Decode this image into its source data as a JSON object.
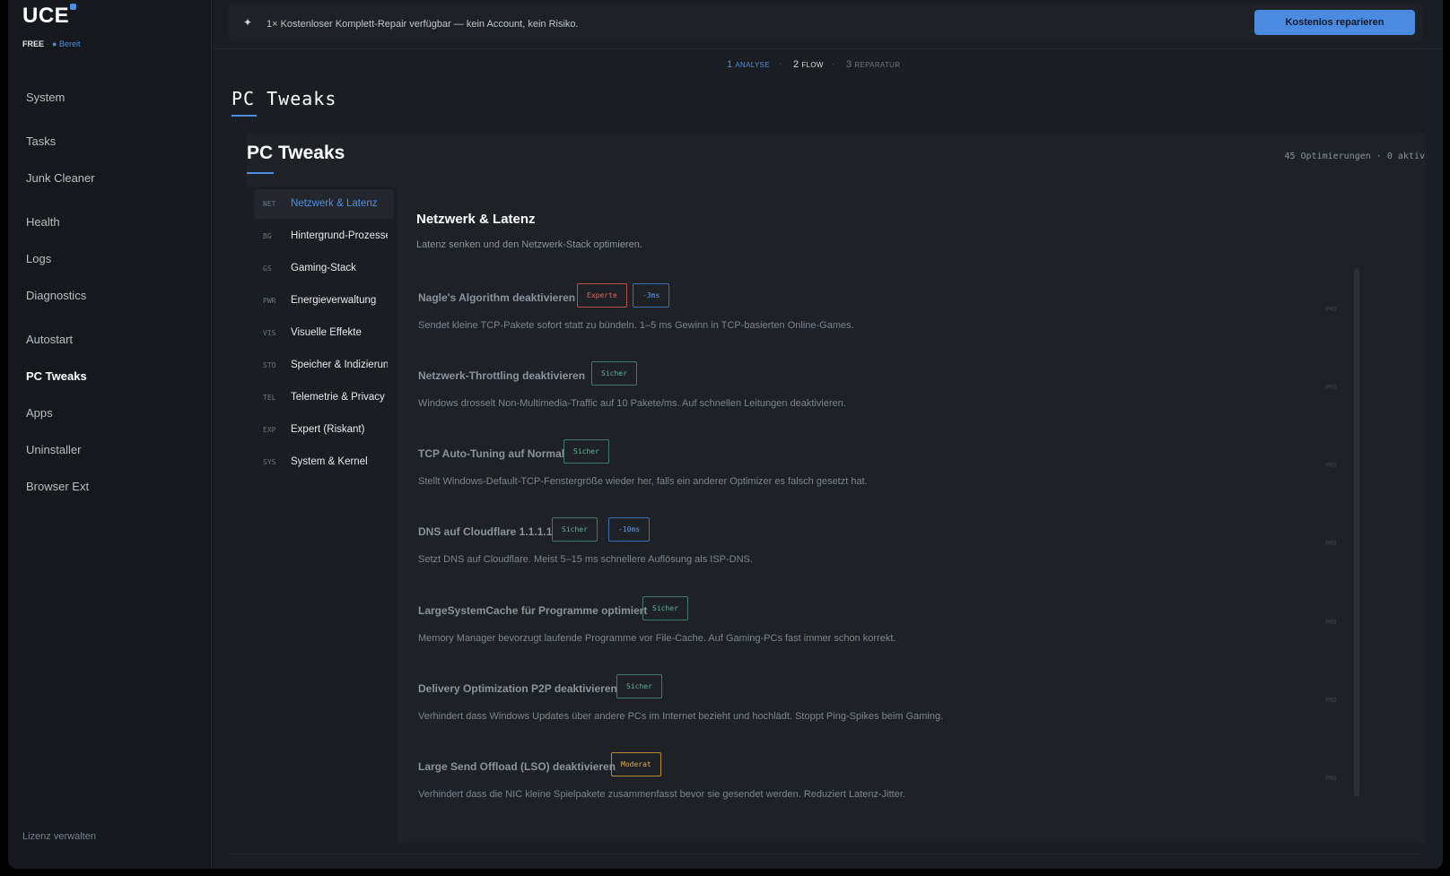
{
  "app": {
    "logo": "UCE",
    "plan": "FREE",
    "status": "Bereit",
    "license_link": "Lizenz verwalten"
  },
  "sidebar": {
    "items": [
      {
        "label": "System"
      },
      {
        "label": "Tasks"
      },
      {
        "label": "Junk Cleaner"
      },
      {
        "label": "Health"
      },
      {
        "label": "Logs"
      },
      {
        "label": "Diagnostics"
      },
      {
        "label": "Autostart"
      },
      {
        "label": "PC Tweaks"
      },
      {
        "label": "Apps"
      },
      {
        "label": "Uninstaller"
      },
      {
        "label": "Browser Ext"
      }
    ],
    "active": "PC Tweaks"
  },
  "promo": {
    "icon": "sparkle-icon",
    "text": "1× Kostenloser Komplett-Repair verfügbar — kein Account, kein Risiko.",
    "button": "Kostenlos reparieren"
  },
  "steps": [
    {
      "num": "1",
      "label": "ANALYSE"
    },
    {
      "num": "2",
      "label": "FLOW"
    },
    {
      "num": "3",
      "label": "REPARATUR"
    }
  ],
  "page": {
    "title": "PC  Tweaks"
  },
  "card": {
    "title": "PC Tweaks",
    "meta": "45 Optimierungen · 0 aktiv"
  },
  "subnav": [
    {
      "code": "NET",
      "label": "Netzwerk & Latenz"
    },
    {
      "code": "BG",
      "label": "Hintergrund-Prozesse"
    },
    {
      "code": "GS",
      "label": "Gaming-Stack"
    },
    {
      "code": "PWR",
      "label": "Energieverwaltung"
    },
    {
      "code": "VIS",
      "label": "Visuelle Effekte"
    },
    {
      "code": "STO",
      "label": "Speicher & Indizierung"
    },
    {
      "code": "TEL",
      "label": "Telemetrie & Privacy"
    },
    {
      "code": "EXP",
      "label": "Expert (Riskant)"
    },
    {
      "code": "SYS",
      "label": "System & Kernel"
    }
  ],
  "section": {
    "title": "Netzwerk & Latenz",
    "desc": "Latenz senken und den Netzwerk-Stack optimieren."
  },
  "tweaks": [
    {
      "title": "Nagle's Algorithm deaktivieren",
      "badges": [
        "Experte",
        "-3ms"
      ],
      "desc": "Sendet kleine TCP-Pakete sofort statt zu bündeln. 1–5 ms Gewinn in TCP-basierten Online-Games.",
      "pro": "PRO"
    },
    {
      "title": "Netzwerk-Throttling deaktivieren",
      "badges": [
        "Sicher"
      ],
      "desc": "Windows drosselt Non-Multimedia-Traffic auf 10 Pakete/ms. Auf schnellen Leitungen deaktivieren.",
      "pro": "PRO"
    },
    {
      "title": "TCP Auto-Tuning auf Normal",
      "badges": [
        "Sicher"
      ],
      "desc": "Stellt Windows-Default-TCP-Fenstergröße wieder her, falls ein anderer Optimizer es falsch gesetzt hat.",
      "pro": "PRO"
    },
    {
      "title": "DNS auf Cloudflare 1.1.1.1",
      "badges": [
        "Sicher",
        "-10ms"
      ],
      "desc": "Setzt DNS auf Cloudflare. Meist 5–15 ms schnellere Auflösung als ISP-DNS.",
      "pro": "PRO"
    },
    {
      "title": "LargeSystemCache für Programme optimiert",
      "badges": [
        "Sicher"
      ],
      "desc": "Memory Manager bevorzugt laufende Programme vor File-Cache. Auf Gaming-PCs fast immer schon korrekt.",
      "pro": "PRO"
    },
    {
      "title": "Delivery Optimization P2P deaktivieren",
      "badges": [
        "Sicher"
      ],
      "desc": "Verhindert dass Windows Updates über andere PCs im Internet bezieht und hochlädt. Stoppt Ping-Spikes beim Gaming.",
      "pro": "PRO"
    },
    {
      "title": "Large Send Offload (LSO) deaktivieren",
      "badges": [
        "Moderat"
      ],
      "desc": "Verhindert dass die NIC kleine Spielpakete zusammenfasst bevor sie gesendet werden. Reduziert Latenz-Jitter.",
      "pro": "PRO"
    }
  ],
  "colors": {
    "accent": "#4a90e2",
    "expert": "#e0665a",
    "safe": "#5fb09a",
    "moderate": "#e0a94a"
  }
}
